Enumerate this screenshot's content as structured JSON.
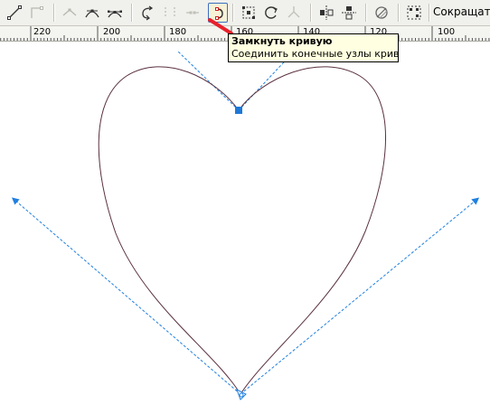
{
  "toolbar": {
    "buttons": [
      {
        "name": "to-line-icon",
        "enabled": true
      },
      {
        "name": "to-curve-icon",
        "enabled": false
      },
      {
        "name": "cusp-node-icon",
        "enabled": false
      },
      {
        "name": "smooth-node-icon",
        "enabled": true
      },
      {
        "name": "symmetrical-node-icon",
        "enabled": true
      },
      {
        "name": "reverse-direction-icon",
        "enabled": true
      },
      {
        "name": "extend-curve-icon",
        "enabled": false
      },
      {
        "name": "extract-subpath-icon",
        "enabled": false
      },
      {
        "name": "close-curve-icon",
        "enabled": true,
        "active": true
      },
      {
        "name": "stretch-scale-nodes-icon",
        "enabled": true
      },
      {
        "name": "rotate-skew-nodes-icon",
        "enabled": true
      },
      {
        "name": "align-nodes-icon",
        "enabled": false
      },
      {
        "name": "reflect-horizontal-icon",
        "enabled": true
      },
      {
        "name": "reflect-vertical-icon",
        "enabled": true
      },
      {
        "name": "elastic-mode-icon",
        "enabled": true
      },
      {
        "name": "select-all-nodes-icon",
        "enabled": true
      }
    ],
    "reduce_label": "Сокращать"
  },
  "ruler": {
    "labels": [
      "220",
      "200",
      "180",
      "160",
      "140",
      "120",
      "100"
    ]
  },
  "tooltip": {
    "title": "Замкнуть кривую",
    "description": "Соединить конечные узлы кривой."
  },
  "colors": {
    "accent": "#1e78d8",
    "pointer": "#e8202a",
    "curve": "#5a3040",
    "guide": "#2080e0"
  }
}
